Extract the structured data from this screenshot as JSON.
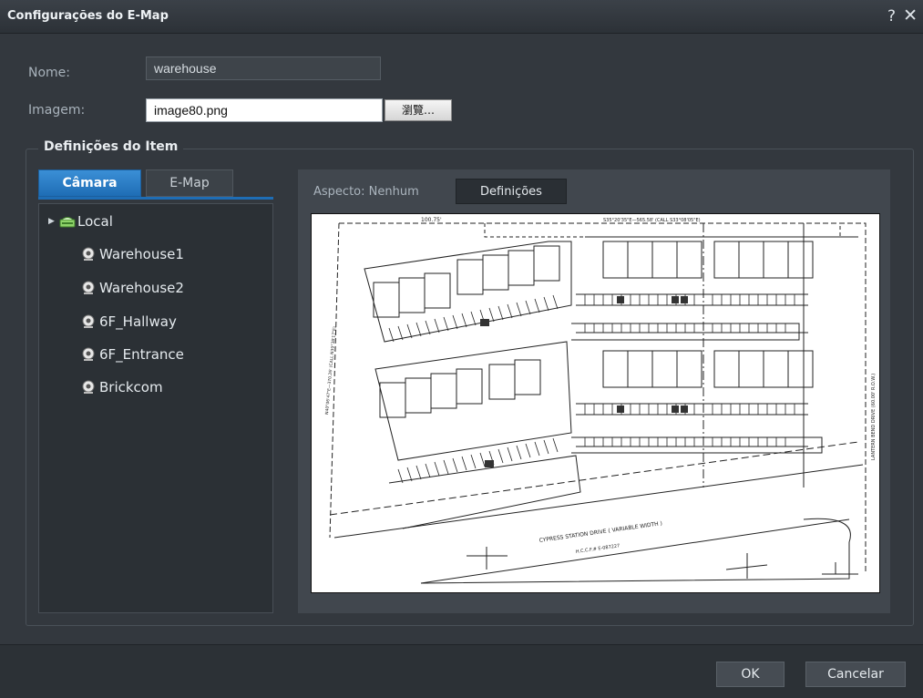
{
  "window": {
    "title": "Configurações do E-Map",
    "help": "?",
    "close": "✕"
  },
  "form": {
    "name_label": "Nome:",
    "name_value": "warehouse",
    "image_label": "Imagem:",
    "image_value": "image80.png",
    "browse_label": "瀏覽…"
  },
  "item_settings": {
    "title": "Definições do Item",
    "tabs": [
      {
        "label": "Câmara",
        "active": true
      },
      {
        "label": "E-Map",
        "active": false
      }
    ],
    "tree": {
      "root": {
        "label": "Local",
        "icon": "server-icon"
      },
      "cameras": [
        {
          "label": "Warehouse1",
          "icon": "camera-icon"
        },
        {
          "label": "Warehouse2",
          "icon": "camera-icon"
        },
        {
          "label": "6F_Hallway",
          "icon": "camera-icon"
        },
        {
          "label": "6F_Entrance",
          "icon": "camera-icon"
        },
        {
          "label": "Brickcom",
          "icon": "camera-icon"
        }
      ]
    }
  },
  "preview": {
    "aspect_text": "Aspecto: Nenhum",
    "settings_button": "Definições",
    "map_texts": {
      "top_dim": "100.75'",
      "top_bearing": "S35°20'35\"E—565.58' (CALL S33°08'05\"E)",
      "right_road": "LANTERN BEND DRIVE (60.00' R.O.W.)",
      "left_bearing": "N40°06'47\"E—370.26' (CALL N39°38'17\"E)",
      "street": "CYPRESS STATION DRIVE ( VARIABLE WIDTH )",
      "street_ref": "H.C.C.F.# E-087227"
    }
  },
  "footer": {
    "ok": "OK",
    "cancel": "Cancelar"
  },
  "colors": {
    "accent": "#1e6db5",
    "background": "#33383e"
  }
}
